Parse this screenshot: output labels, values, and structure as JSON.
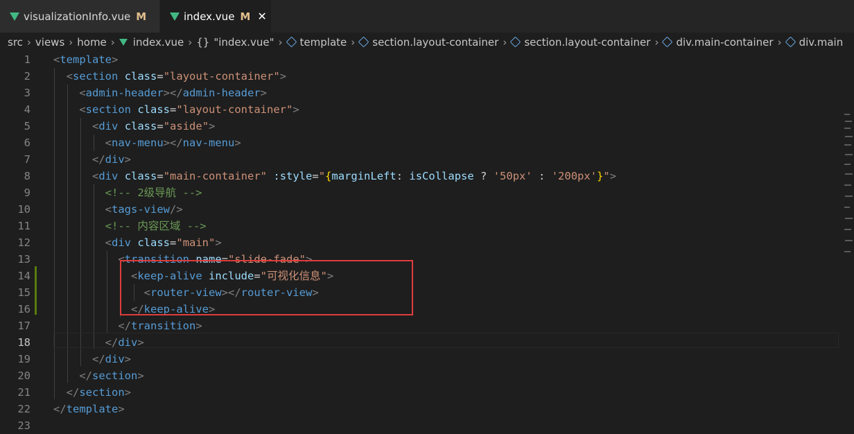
{
  "tabs": [
    {
      "label": "visualizationInfo.vue",
      "status": "M"
    },
    {
      "label": "index.vue",
      "status": "M",
      "close": "✕"
    }
  ],
  "breadcrumb": [
    "src",
    "views",
    "home",
    "index.vue",
    "\"index.vue\"",
    "template",
    "section.layout-container",
    "section.layout-container",
    "div.main-container",
    "div.main"
  ],
  "line_numbers": [
    "1",
    "2",
    "3",
    "4",
    "5",
    "6",
    "7",
    "8",
    "9",
    "10",
    "11",
    "12",
    "13",
    "14",
    "15",
    "16",
    "17",
    "18",
    "19",
    "20",
    "21",
    "22",
    "23"
  ],
  "code": {
    "l1_open": "<",
    "l1_tag": "template",
    "l1_close": ">",
    "l2_tag": "section",
    "l2_attr": "class",
    "l2_val": "\"layout-container\"",
    "l3_tag": "admin-header",
    "l4_tag": "section",
    "l4_attr": "class",
    "l4_val": "\"layout-container\"",
    "l5_tag": "div",
    "l5_attr": "class",
    "l5_val": "\"aside\"",
    "l6_tag": "nav-menu",
    "l7_tag": "div",
    "l8_tag": "div",
    "l8_attr": "class",
    "l8_val": "\"main-container\"",
    "l8_attr2": ":style",
    "l8_q1": "\"",
    "l8_brace_open": "{",
    "l8_key": "marginLeft",
    "l8_colon": ": ",
    "l8_var": "isCollapse",
    "l8_q": " ? ",
    "l8_v1": "'50px'",
    "l8_c": " : ",
    "l8_v2": "'200px'",
    "l8_brace_close": "}",
    "l8_q2": "\"",
    "l9_comment": "<!-- 2级导航 -->",
    "l10_tag": "tags-view",
    "l11_comment": "<!-- 内容区域 -->",
    "l12_tag": "div",
    "l12_attr": "class",
    "l12_val": "\"main\"",
    "l13_tag": "transition",
    "l13_attr": "name",
    "l13_val": "\"slide-fade\"",
    "l14_tag": "keep-alive",
    "l14_attr": "include",
    "l14_val": "\"可视化信息\"",
    "l15_tag": "router-view",
    "l16_tag": "keep-alive",
    "l17_tag": "transition",
    "l18_tag": "div",
    "l19_tag": "div",
    "l20_tag": "section",
    "l21_tag": "section",
    "l22_tag": "template"
  },
  "colors": {
    "tag": "#569cd6",
    "attr": "#9cdcfe",
    "string": "#ce9178",
    "comment": "#6a9955",
    "highlight_box": "#e03c3c"
  }
}
